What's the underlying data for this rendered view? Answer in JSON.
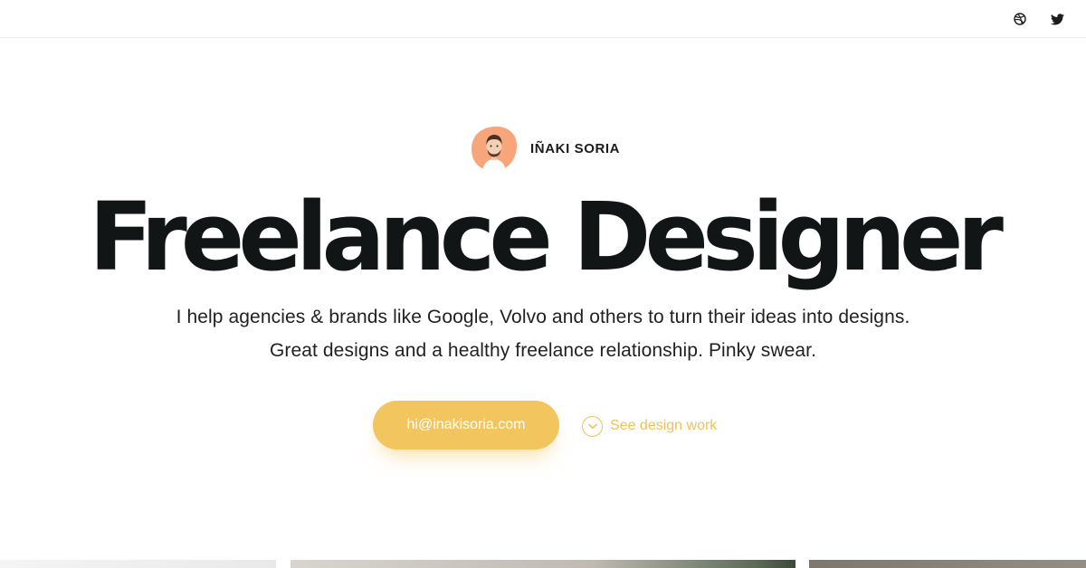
{
  "header": {
    "social": [
      {
        "icon": "dribbble-icon"
      },
      {
        "icon": "twitter-icon"
      }
    ]
  },
  "profile": {
    "name": "IÑAKI SORIA",
    "avatar_color": "#f7a67c"
  },
  "hero": {
    "title": "Freelance Designer",
    "subtitle_line1": "I help agencies & brands like Google, Volvo and others to turn their ideas into designs.",
    "subtitle_line2": "Great designs and a healthy freelance relationship. Pinky swear."
  },
  "cta": {
    "email_label": "hi@inakisoria.com",
    "work_label": "See design work",
    "accent_color": "#f3c55e"
  },
  "gallery": {
    "thumbnails": [
      "thumbnail-1",
      "thumbnail-2",
      "thumbnail-3"
    ]
  }
}
